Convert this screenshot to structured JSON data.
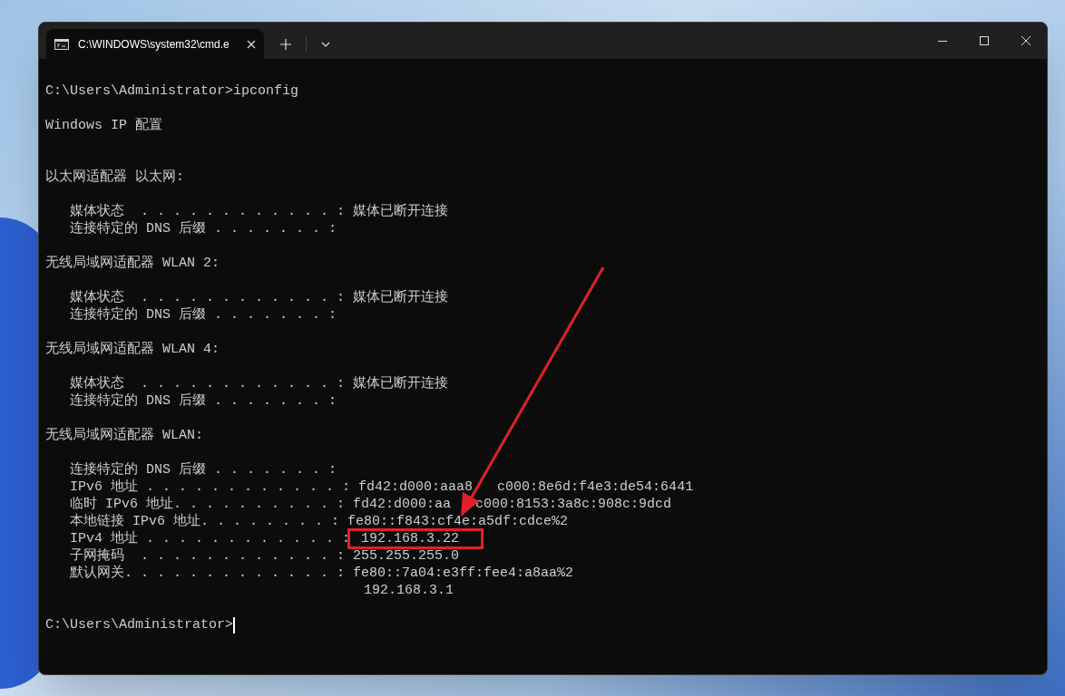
{
  "tab": {
    "title": "C:\\WINDOWS\\system32\\cmd.e"
  },
  "lines": [
    {
      "kind": "text",
      "text": "C:\\Users\\Administrator>ipconfig"
    },
    {
      "kind": "blank"
    },
    {
      "kind": "text",
      "text": "Windows IP 配置"
    },
    {
      "kind": "blank"
    },
    {
      "kind": "blank"
    },
    {
      "kind": "text",
      "text": "以太网适配器 以太网:"
    },
    {
      "kind": "blank"
    },
    {
      "kind": "text",
      "text": "   媒体状态  . . . . . . . . . . . . : ",
      "value": "媒体已断开连接",
      "highlighted": false
    },
    {
      "kind": "text",
      "text": "   连接特定的 DNS 后缀 . . . . . . . :"
    },
    {
      "kind": "blank"
    },
    {
      "kind": "text",
      "text": "无线局域网适配器 WLAN 2:"
    },
    {
      "kind": "blank"
    },
    {
      "kind": "text",
      "text": "   媒体状态  . . . . . . . . . . . . : ",
      "value": "媒体已断开连接",
      "highlighted": false
    },
    {
      "kind": "text",
      "text": "   连接特定的 DNS 后缀 . . . . . . . :"
    },
    {
      "kind": "blank"
    },
    {
      "kind": "text",
      "text": "无线局域网适配器 WLAN 4:"
    },
    {
      "kind": "blank"
    },
    {
      "kind": "text",
      "text": "   媒体状态  . . . . . . . . . . . . : ",
      "value": "媒体已断开连接",
      "highlighted": false
    },
    {
      "kind": "text",
      "text": "   连接特定的 DNS 后缀 . . . . . . . :"
    },
    {
      "kind": "blank"
    },
    {
      "kind": "text",
      "text": "无线局域网适配器 WLAN:"
    },
    {
      "kind": "blank"
    },
    {
      "kind": "text",
      "text": "   连接特定的 DNS 后缀 . . . . . . . :"
    },
    {
      "kind": "text",
      "text": "   IPv6 地址 . . . . . . . . . . . . : ",
      "value_parts": [
        "fd42:d000:aaa8",
        "c000:8e6d:f4e3:de54:6441"
      ]
    },
    {
      "kind": "text",
      "text": "   临时 IPv6 地址. . . . . . . . . . : ",
      "value_parts": [
        "fd42:d000:aa",
        "c000:8153:3a8c:908c:9dcd"
      ]
    },
    {
      "kind": "text",
      "text": "   本地链接 IPv6 地址. . . . . . . . : ",
      "value": "fe80::f843:cf4e:a5df:cdce%2",
      "highlighted": false
    },
    {
      "kind": "text",
      "text": "   IPv4 地址 . . . . . . . . . . . . : ",
      "value": "192.168.3.22",
      "highlighted": true
    },
    {
      "kind": "text",
      "text": "   子网掩码  . . . . . . . . . . . . : ",
      "value": "255.255.255.0",
      "highlighted": false
    },
    {
      "kind": "text",
      "text": "   默认网关. . . . . . . . . . . . . : ",
      "value": "fe80::7a04:e3ff:fee4:a8aa%2",
      "highlighted": false
    },
    {
      "kind": "text",
      "text": "                                       192.168.3.1"
    },
    {
      "kind": "blank"
    },
    {
      "kind": "prompt",
      "text": "C:\\Users\\Administrator>"
    }
  ]
}
